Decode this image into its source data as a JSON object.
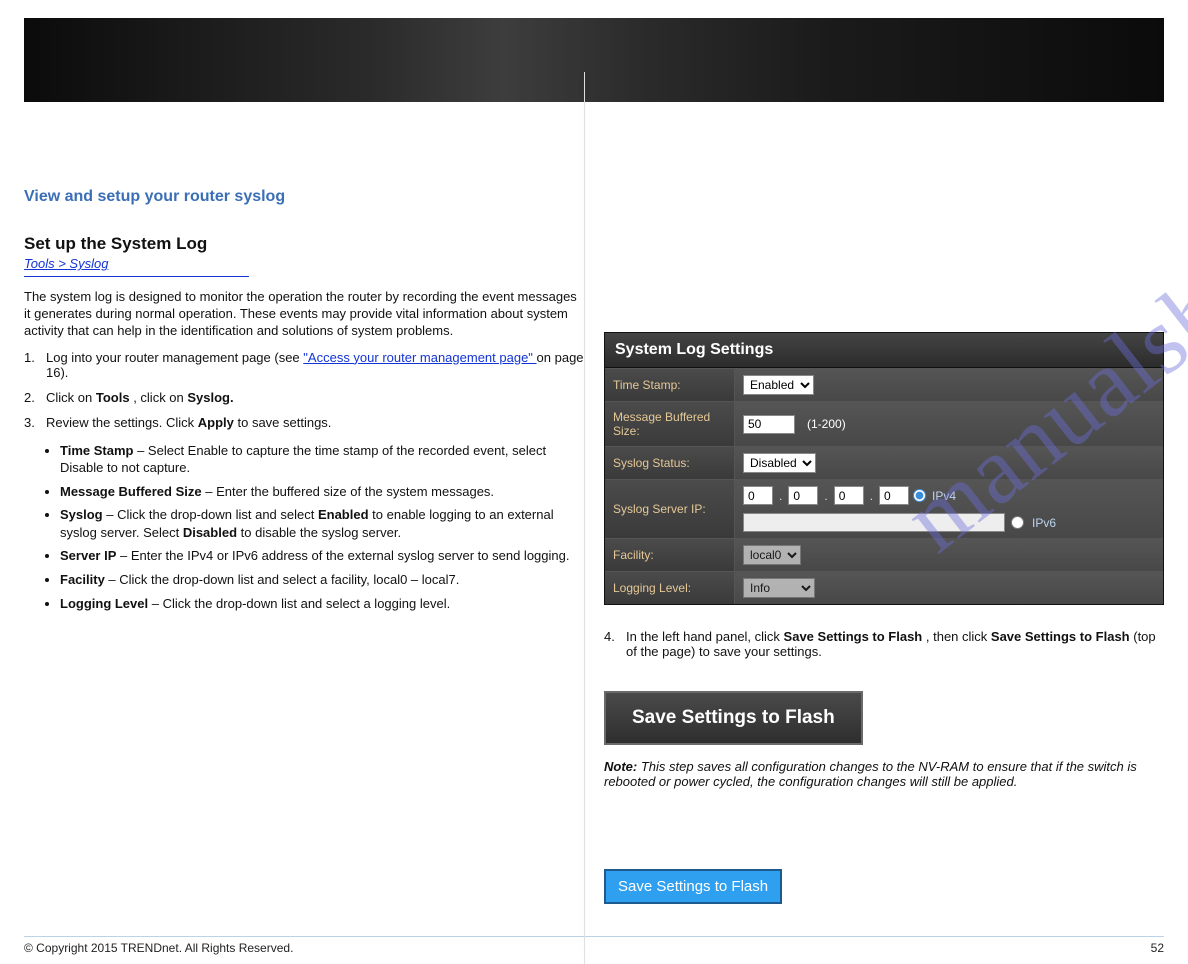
{
  "banner": {},
  "left": {
    "section_title": "View and setup your router syslog",
    "sub_title": "Set up the System Log",
    "nav_label": "Tools > Syslog",
    "intro": "The system log is designed to monitor the operation the router by recording the event messages it generates during normal operation. These events may provide vital information about system activity that can help in the identification and solutions of system problems.",
    "step1_num": "1.",
    "step1_txt": "Log into your router management page (see",
    "step1_link": " \"Access your router management page\" ",
    "step1_after": "on page 16).",
    "step2_num": "2.",
    "step2_txt_a": "Click on ",
    "step2_b1": "Tools",
    "step2_mid": ", click on ",
    "step2_b2": "Syslog.",
    "step3_num": "3.",
    "step3_txt": "Review the settings. Click ",
    "step3_b": "Apply",
    "step3_after": " to save settings.",
    "bullets": {
      "time_stamp_b": "Time Stamp",
      "time_stamp_t": " – Select Enable to capture the time stamp of the recorded event, select Disable to not capture.",
      "msg_buf_b": "Message Buffered Size",
      "msg_buf_t": " – Enter the buffered size of the system messages.",
      "syslog_b": "Syslog",
      "syslog_t": " – Click the drop-down list and select ",
      "syslog_b2": "Enabled",
      "syslog_t2": " to enable logging to an external syslog server. Select ",
      "syslog_b3": "Disabled",
      "syslog_t3": " to disable the syslog server.",
      "srv_b": "Server IP",
      "srv_t": " – Enter the IPv4 or IPv6 address of the external syslog server to send logging.",
      "fac_b": "Facility",
      "fac_t": " – Click the drop-down list and select a facility, local0 – local7.",
      "lvl_b": "Logging Level",
      "lvl_t": " – Click the drop-down list and select a logging level."
    }
  },
  "panel": {
    "title": "System Log Settings",
    "rows": {
      "time_stamp": {
        "label": "Time Stamp:",
        "value": "Enabled"
      },
      "msg_buf": {
        "label": "Message Buffered Size:",
        "value": "50",
        "hint": "(1-200)"
      },
      "syslog_status": {
        "label": "Syslog Status:",
        "value": "Disabled"
      },
      "server_ip": {
        "label": "Syslog Server IP:",
        "o1": "0",
        "o2": "0",
        "o3": "0",
        "o4": "0",
        "ipv4_label": "IPv4",
        "ipv6_label": "IPv6"
      },
      "facility": {
        "label": "Facility:",
        "value": "local0"
      },
      "log_level": {
        "label": "Logging Level:",
        "value": "Info"
      }
    }
  },
  "right_text": {
    "step4_num": "4.",
    "step4_txt": "In the left hand panel, click ",
    "step4_b": "Save Settings to Flash",
    "step4_after": ", then click ",
    "step4_b2": "Save Settings to Flash",
    "step4_after2": " (top of the page) to save your settings.",
    "btn_dark": "Save Settings to Flash",
    "note_h": "Note:",
    "note_t": " This step saves all configuration changes to the NV-RAM to ensure that if the switch is rebooted or power cycled, the configuration changes will still be applied.",
    "btn_blue": "Save Settings to Flash"
  },
  "footer": {
    "copyright": "© Copyright 2015 TRENDnet. All Rights Reserved.",
    "page": "52"
  },
  "watermark": "manualshive.com"
}
